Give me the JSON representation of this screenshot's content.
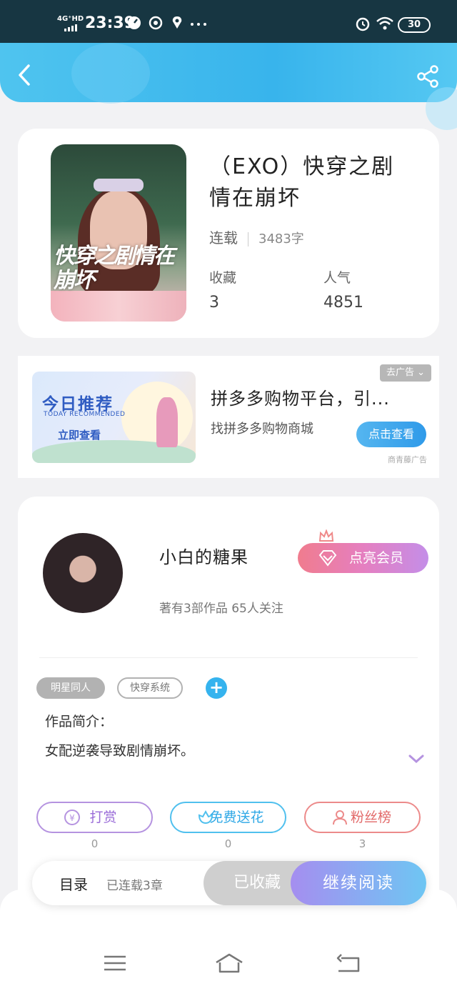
{
  "status_bar": {
    "network": "4G⁺HD",
    "time": "23:39",
    "battery": "30"
  },
  "header": {
    "back_icon": "chevron-left-icon",
    "share_icon": "share-icon"
  },
  "book": {
    "title": "（EXO）快穿之剧情在崩坏",
    "cover_title": "快穿之剧情在崩坏",
    "status": "连载",
    "word_count": "3483字",
    "favorites_label": "收藏",
    "favorites_value": "3",
    "popularity_label": "人气",
    "popularity_value": "4851"
  },
  "ad": {
    "image_title": "今日推荐",
    "image_subtitle": "TODAY RECOMMENDED",
    "image_cta": "立即查看",
    "title": "拼多多购物平台，引...",
    "subtitle": "找拼多多购物商城",
    "close_label": "去广告",
    "button_label": "点击查看",
    "source": "商青藤广告"
  },
  "author": {
    "name": "小白的糖果",
    "meta": "著有3部作品 65人关注",
    "vip_button": "点亮会员",
    "tags": [
      "明星同人",
      "快穿系统"
    ],
    "intro_label": "作品简介：",
    "intro_text": "女配逆袭导致剧情崩坏。",
    "actions": [
      {
        "label": "打赏",
        "count": "0",
        "icon": "yuan-coin-icon"
      },
      {
        "label": "免费送花",
        "count": "0",
        "icon": "flower-icon"
      },
      {
        "label": "粉丝榜",
        "count": "3",
        "icon": "person-icon"
      }
    ]
  },
  "action_bar": {
    "toc_label": "目录",
    "chapter_status": "已连载3章",
    "collected_label": "已收藏",
    "read_label": "继续阅读"
  },
  "colors": {
    "header": "#38b4ec",
    "accent_blue": "#35b3ee",
    "vip_pink": "#f07c8e",
    "read_purple": "#a58ef0"
  }
}
